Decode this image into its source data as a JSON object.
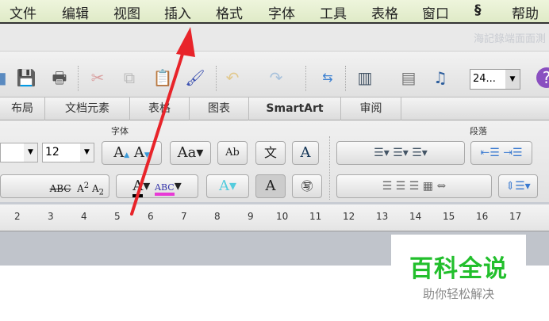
{
  "menubar": {
    "items": [
      "文件",
      "编辑",
      "视图",
      "插入",
      "格式",
      "字体",
      "工具",
      "表格",
      "窗口",
      "帮助"
    ],
    "script_icon": "script-icon"
  },
  "title": {
    "text": "海記錄端面面測"
  },
  "toolbar": {
    "zoom_value": "24..."
  },
  "tabs": [
    "布局",
    "文档元素",
    "表格",
    "图表",
    "SmartArt",
    "审阅"
  ],
  "ribbon": {
    "font_group": "字体",
    "paragraph_group": "段落",
    "font_size": "12"
  },
  "ruler": [
    "2",
    "3",
    "4",
    "5",
    "6",
    "7",
    "8",
    "9",
    "10",
    "11",
    "12",
    "13",
    "14",
    "15",
    "16",
    "17"
  ],
  "watermark": {
    "title": "百科全说",
    "subtitle": "助你轻松解决"
  },
  "colors": {
    "arrow": "#e8242a",
    "watermark": "#22bf2c",
    "highlight": "#e83ad6"
  }
}
